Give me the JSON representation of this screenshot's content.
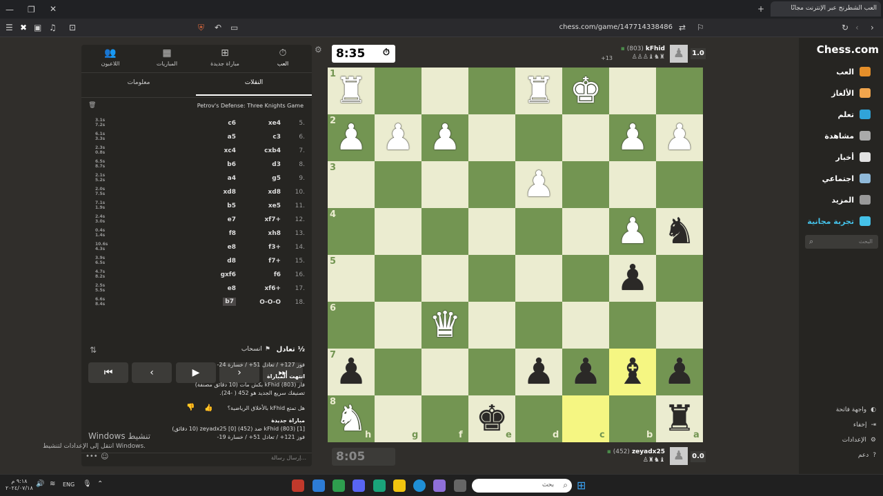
{
  "browser": {
    "tab_title": "العب الشطرنج عبر الإنترنت مجانًا",
    "url": "chess.com/game/147714338486"
  },
  "left_tabs": [
    {
      "label": "العب",
      "icon": "stopwatch-icon"
    },
    {
      "label": "مباراة جديدة",
      "icon": "plus-icon"
    },
    {
      "label": "المباريات",
      "icon": "board-icon"
    },
    {
      "label": "اللاعبون",
      "icon": "players-icon"
    }
  ],
  "subtabs": {
    "moves": "النقلات",
    "info": "معلومات"
  },
  "opening": "Petrov's Defense: Three Knights Game",
  "moves": [
    {
      "n": "5.",
      "w": "xe4",
      "b": "c6",
      "tw": "3.1s",
      "tb": "7.2s"
    },
    {
      "n": "6.",
      "w": "c3",
      "b": "a5",
      "tw": "6.1s",
      "tb": "3.3s"
    },
    {
      "n": "7.",
      "w": "cxb4",
      "b": "xc4",
      "tw": "2.3s",
      "tb": "0.8s"
    },
    {
      "n": "8.",
      "w": "d3",
      "b": "b6",
      "tw": "6.5s",
      "tb": "8.7s"
    },
    {
      "n": "9.",
      "w": "g5",
      "b": "a4",
      "tw": "2.1s",
      "tb": "5.2s"
    },
    {
      "n": "10.",
      "w": "xd8",
      "b": "xd8",
      "tw": "2.0s",
      "tb": "7.5s"
    },
    {
      "n": "11.",
      "w": "xe5",
      "b": "b5",
      "tw": "7.1s",
      "tb": "1.9s"
    },
    {
      "n": "12.",
      "w": "xf7+",
      "b": "e7",
      "tw": "2.4s",
      "tb": "3.0s"
    },
    {
      "n": "13.",
      "w": "xh8",
      "b": "f8",
      "tw": "0.4s",
      "tb": "1.4s"
    },
    {
      "n": "14.",
      "w": "f3+",
      "b": "e8",
      "tw": "10.6s",
      "tb": "4.3s"
    },
    {
      "n": "15.",
      "w": "f7+",
      "b": "d8",
      "tw": "3.9s",
      "tb": "6.5s"
    },
    {
      "n": "16.",
      "w": "f6",
      "b": "gxf6",
      "tw": "4.7s",
      "tb": "8.2s"
    },
    {
      "n": "17.",
      "w": "xf6+",
      "b": "e8",
      "tw": "2.5s",
      "tb": "5.5s"
    },
    {
      "n": "18.",
      "w": "O-O-O",
      "b": "b7",
      "tw": "6.6s",
      "tb": "8.4s"
    }
  ],
  "actions": {
    "draw": "تعادل",
    "resign": "انسحاب",
    "half": "½"
  },
  "info": {
    "line1": "فوز 127+ / تعادل 51+ / خسارة 24-",
    "ended": "انتهت المباراة",
    "won": "فاز kFhid (803) بكش مات (10 دقائق مصنفة)",
    "rating": "تصنيفك سريع الجديد هو 452 ( -24).",
    "question": "هل تمتع kFhid بالأخلاق الرياضية؟",
    "new_game": "مباراة جديدة",
    "game_line": "[1] kFhid (803) ضد (452) zeyadx25 [0] (10 دقائق)",
    "line2": "فوز 121+ / تعادل 51+ / خسارة 19-",
    "chat_placeholder": "إرسال رسالة...",
    "windows1": "Windows تنشيط",
    "windows2": "انتقل إلى الإعدادات لتنشيط Windows."
  },
  "top_player": {
    "name": "kFhid",
    "rating": "(803)",
    "clock": "8:35",
    "score": "1.0",
    "material": "+13"
  },
  "bottom_player": {
    "name": "zeyadx25",
    "rating": "(452)",
    "clock": "8:05",
    "score": "0.0"
  },
  "board": {
    "ranks": [
      "1",
      "2",
      "3",
      "4",
      "5",
      "6",
      "7",
      "8"
    ],
    "files": [
      "h",
      "g",
      "f",
      "e",
      "d",
      "c",
      "b",
      "a"
    ],
    "pieces": [
      {
        "sq": "h1",
        "p": "♜",
        "c": "w"
      },
      {
        "sq": "d1",
        "p": "♜",
        "c": "w"
      },
      {
        "sq": "c1",
        "p": "♚",
        "c": "w"
      },
      {
        "sq": "h2",
        "p": "♟",
        "c": "w"
      },
      {
        "sq": "g2",
        "p": "♟",
        "c": "w"
      },
      {
        "sq": "f2",
        "p": "♟",
        "c": "w"
      },
      {
        "sq": "b2",
        "p": "♟",
        "c": "w"
      },
      {
        "sq": "a2",
        "p": "♟",
        "c": "w"
      },
      {
        "sq": "d3",
        "p": "♟",
        "c": "w"
      },
      {
        "sq": "b4",
        "p": "♟",
        "c": "w"
      },
      {
        "sq": "a4",
        "p": "♞",
        "c": "b"
      },
      {
        "sq": "b5",
        "p": "♟",
        "c": "b"
      },
      {
        "sq": "f6",
        "p": "♛",
        "c": "w"
      },
      {
        "sq": "h7",
        "p": "♟",
        "c": "b"
      },
      {
        "sq": "d7",
        "p": "♟",
        "c": "b"
      },
      {
        "sq": "c7",
        "p": "♟",
        "c": "b"
      },
      {
        "sq": "b7",
        "p": "♝",
        "c": "b"
      },
      {
        "sq": "a7",
        "p": "♟",
        "c": "b"
      },
      {
        "sq": "h8",
        "p": "♞",
        "c": "w"
      },
      {
        "sq": "e8",
        "p": "♚",
        "c": "b"
      },
      {
        "sq": "a8",
        "p": "♜",
        "c": "b"
      }
    ],
    "highlight": [
      "b7",
      "c8"
    ]
  },
  "right_nav": [
    {
      "label": "العب",
      "color": "#e58f2a"
    },
    {
      "label": "الألغاز",
      "color": "#f1a54d"
    },
    {
      "label": "تعلم",
      "color": "#30a4d9"
    },
    {
      "label": "مشاهدة",
      "color": "#aaaaaa"
    },
    {
      "label": "أخبار",
      "color": "#e2e2e2"
    },
    {
      "label": "اجتماعي",
      "color": "#8fb9d9"
    },
    {
      "label": "المزيد",
      "color": "#999999"
    },
    {
      "label": "تجربة مجانية",
      "color": "#45c1e8"
    }
  ],
  "search_placeholder": "البحث",
  "logo": "Chess.com",
  "side_bottom": [
    "واجهة فاتحة",
    "إخفاء",
    "الإعدادات",
    "دعم"
  ],
  "taskbar": {
    "search": "بحث",
    "lang": "ENG",
    "time": "٩:١٨ م",
    "date": "٢٠٢٤/٠٧/١٨"
  }
}
